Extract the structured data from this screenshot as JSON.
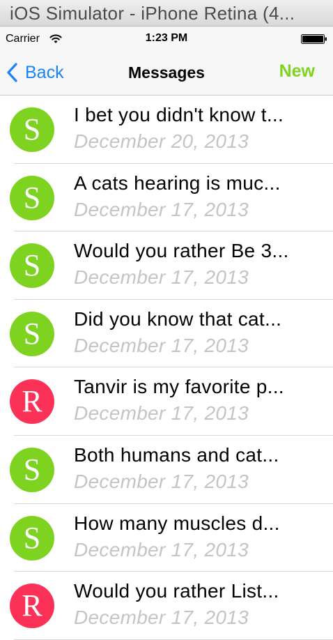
{
  "simulator": {
    "title": "iOS Simulator - iPhone Retina (4..."
  },
  "status_bar": {
    "carrier": "Carrier",
    "time": "1:23 PM",
    "wifi_icon": "wifi-icon",
    "battery_icon": "battery-icon"
  },
  "nav": {
    "back_label": "Back",
    "back_icon": "chevron-left-icon",
    "title": "Messages",
    "new_label": "New",
    "back_color": "#1a82fb",
    "new_color": "#7ed321"
  },
  "colors": {
    "avatar_green": "#7ed321",
    "avatar_red": "#fc3158",
    "date_gray": "#c4c4c8"
  },
  "messages": [
    {
      "avatar": "S",
      "color": "green",
      "title": "I bet you didn't know t...",
      "date": "December 20, 2013"
    },
    {
      "avatar": "S",
      "color": "green",
      "title": "A cats hearing is muc...",
      "date": "December 17, 2013"
    },
    {
      "avatar": "S",
      "color": "green",
      "title": "Would you rather Be 3...",
      "date": "December 17, 2013"
    },
    {
      "avatar": "S",
      "color": "green",
      "title": "Did you know that cat...",
      "date": "December 17, 2013"
    },
    {
      "avatar": "R",
      "color": "red",
      "title": "Tanvir is my favorite p...",
      "date": "December 17, 2013"
    },
    {
      "avatar": "S",
      "color": "green",
      "title": "Both humans and cat...",
      "date": "December 17, 2013"
    },
    {
      "avatar": "S",
      "color": "green",
      "title": "How many muscles d...",
      "date": "December 17, 2013"
    },
    {
      "avatar": "R",
      "color": "red",
      "title": "Would you rather List...",
      "date": "December 17, 2013"
    }
  ]
}
